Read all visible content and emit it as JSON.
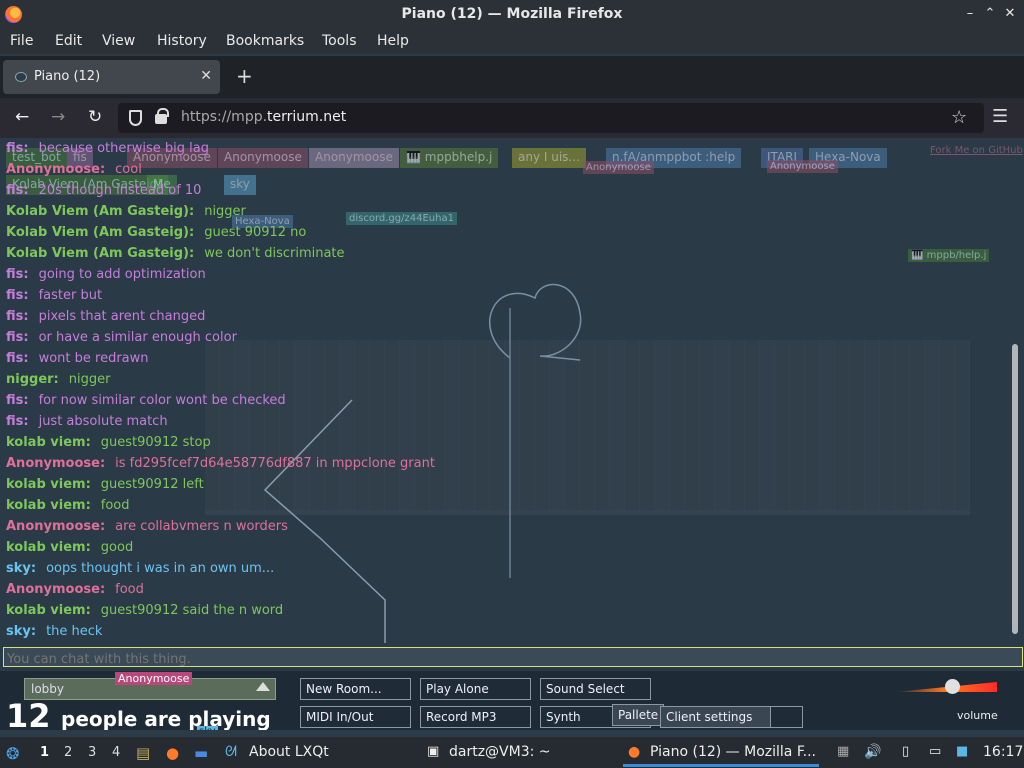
{
  "window": {
    "title": "Piano (12) — Mozilla Firefox",
    "controls": [
      "–",
      "⌃",
      "✕"
    ]
  },
  "menu": [
    "File",
    "Edit",
    "View",
    "History",
    "Bookmarks",
    "Tools",
    "Help"
  ],
  "tabs": [
    {
      "label": "Piano (12)",
      "close": "✕"
    }
  ],
  "newtab_label": "+",
  "nav": {
    "back": "←",
    "forward": "→",
    "reload": "↻",
    "url_prefix": "https://mpp.",
    "url_domain": "terrium.net",
    "star": "☆",
    "menu": "☰"
  },
  "userstrip": [
    {
      "label": "test_bot",
      "color": "#4a7a3a"
    },
    {
      "label": "fis",
      "color": "#8e6a9a"
    },
    {
      "label": "Anonymoose",
      "color": "#8d4e66"
    },
    {
      "label": "Anonymoose",
      "color": "#8d4e66"
    },
    {
      "label": "Anonymoose",
      "color": "#9f8fb0"
    },
    {
      "label": "🎹 mppbhelp.j",
      "color": "#5b7a3a"
    },
    {
      "label": "any I uis...",
      "color": "#a0a030"
    },
    {
      "label": "n.fA/anmppbot :help",
      "color": "#4d7aa8"
    },
    {
      "label": "ITARI",
      "color": "#4d6fa8"
    },
    {
      "label": "Hexa-Nova",
      "color": "#4d7aa8"
    }
  ],
  "userstrip2": [
    {
      "label": "Kolab Viem (Am Gasteig)",
      "color": "#4a7a3a"
    },
    {
      "label": "Me",
      "color": "#4a8a4a"
    },
    {
      "label": "sky",
      "color": "#5ba0c8"
    }
  ],
  "cursor_tags": [
    {
      "label": "Anonymoose",
      "color": "#8d4e66"
    },
    {
      "label": "Anonymoose",
      "color": "#8d4e66"
    },
    {
      "label": "Hexa-Nova",
      "color": "#4d7aa8"
    },
    {
      "label": "discord.gg/z44Euha1",
      "color": "#3a8a8a"
    },
    {
      "label": "🎹 mppb/help.j",
      "color": "#4a7a3a"
    },
    {
      "label": "Fork Me on GitHub",
      "color": "#8d4e66"
    }
  ],
  "messages": [
    {
      "who": "fis:",
      "text": "because otherwise big lag",
      "color": "#c77ddb",
      "textcolor": "#c77ddb"
    },
    {
      "who": "Anonymoose:",
      "text": "cool",
      "color": "#e0709a",
      "textcolor": "#e0709a"
    },
    {
      "who": "fis:",
      "text": "20s though instead of 10",
      "color": "#c77ddb",
      "textcolor": "#c77ddb"
    },
    {
      "who": "Kolab Viem (Am Gasteig):",
      "text": "nigger",
      "color": "#7ec85a",
      "textcolor": "#7ec85a"
    },
    {
      "who": "Kolab Viem (Am Gasteig):",
      "text": "guest 90912 no",
      "color": "#7ec85a",
      "textcolor": "#7ec85a"
    },
    {
      "who": "Kolab Viem (Am Gasteig):",
      "text": "we don't discriminate",
      "color": "#7ec85a",
      "textcolor": "#7ec85a"
    },
    {
      "who": "fis:",
      "text": "going to add optimization",
      "color": "#c77ddb",
      "textcolor": "#c77ddb"
    },
    {
      "who": "fis:",
      "text": "faster but",
      "color": "#c77ddb",
      "textcolor": "#c77ddb"
    },
    {
      "who": "fis:",
      "text": "pixels that arent changed",
      "color": "#c77ddb",
      "textcolor": "#c77ddb"
    },
    {
      "who": "fis:",
      "text": "or have a similar enough color",
      "color": "#c77ddb",
      "textcolor": "#c77ddb"
    },
    {
      "who": "fis:",
      "text": "wont be redrawn",
      "color": "#c77ddb",
      "textcolor": "#c77ddb"
    },
    {
      "who": "nigger:",
      "text": "nigger",
      "color": "#7ec85a",
      "textcolor": "#7ec85a"
    },
    {
      "who": "fis:",
      "text": "for now similar color wont be checked",
      "color": "#c77ddb",
      "textcolor": "#c77ddb"
    },
    {
      "who": "fis:",
      "text": "just absolute match",
      "color": "#c77ddb",
      "textcolor": "#c77ddb"
    },
    {
      "who": "kolab viem:",
      "text": "guest90912 stop",
      "color": "#7ec85a",
      "textcolor": "#7ec85a"
    },
    {
      "who": "Anonymoose:",
      "text": "is fd295fcef7d64e58776df887 in mppclone grant",
      "color": "#e0709a",
      "textcolor": "#e0709a"
    },
    {
      "who": "kolab viem:",
      "text": "guest90912 left",
      "color": "#7ec85a",
      "textcolor": "#7ec85a"
    },
    {
      "who": "kolab viem:",
      "text": "food",
      "color": "#7ec85a",
      "textcolor": "#7ec85a"
    },
    {
      "who": "Anonymoose:",
      "text": "are collabvmers n worders",
      "color": "#e0709a",
      "textcolor": "#e0709a"
    },
    {
      "who": "kolab viem:",
      "text": "good",
      "color": "#7ec85a",
      "textcolor": "#7ec85a"
    },
    {
      "who": "sky:",
      "text": "oops thought i was in an own um...",
      "color": "#6cc3f0",
      "textcolor": "#6cc3f0"
    },
    {
      "who": "Anonymoose:",
      "text": "food",
      "color": "#e0709a",
      "textcolor": "#e0709a"
    },
    {
      "who": "kolab viem:",
      "text": "guest90912 said the n word",
      "color": "#7ec85a",
      "textcolor": "#7ec85a"
    },
    {
      "who": "sky:",
      "text": "the heck",
      "color": "#6cc3f0",
      "textcolor": "#6cc3f0"
    }
  ],
  "chat_input": {
    "placeholder": "You can chat with this thing."
  },
  "bottom": {
    "room": "lobby",
    "anon_tag": "Anonymoose",
    "count": "12",
    "count_label": "people are playing",
    "sky_tag": "sky",
    "buttons": [
      "New Room...",
      "Play Alone",
      "Sound Select",
      "MIDI In/Out",
      "Record MP3",
      "Synth",
      "Pallete",
      "Client settings"
    ],
    "volume_label": "volume",
    "volume_level": 0.5
  },
  "taskbar": {
    "desktops": [
      "1",
      "2",
      "3",
      "4"
    ],
    "about": "About LXQt",
    "terminal": "dartz@VM3: ~",
    "firefox": "Piano (12) — Mozilla F...",
    "clock": "16:17"
  }
}
